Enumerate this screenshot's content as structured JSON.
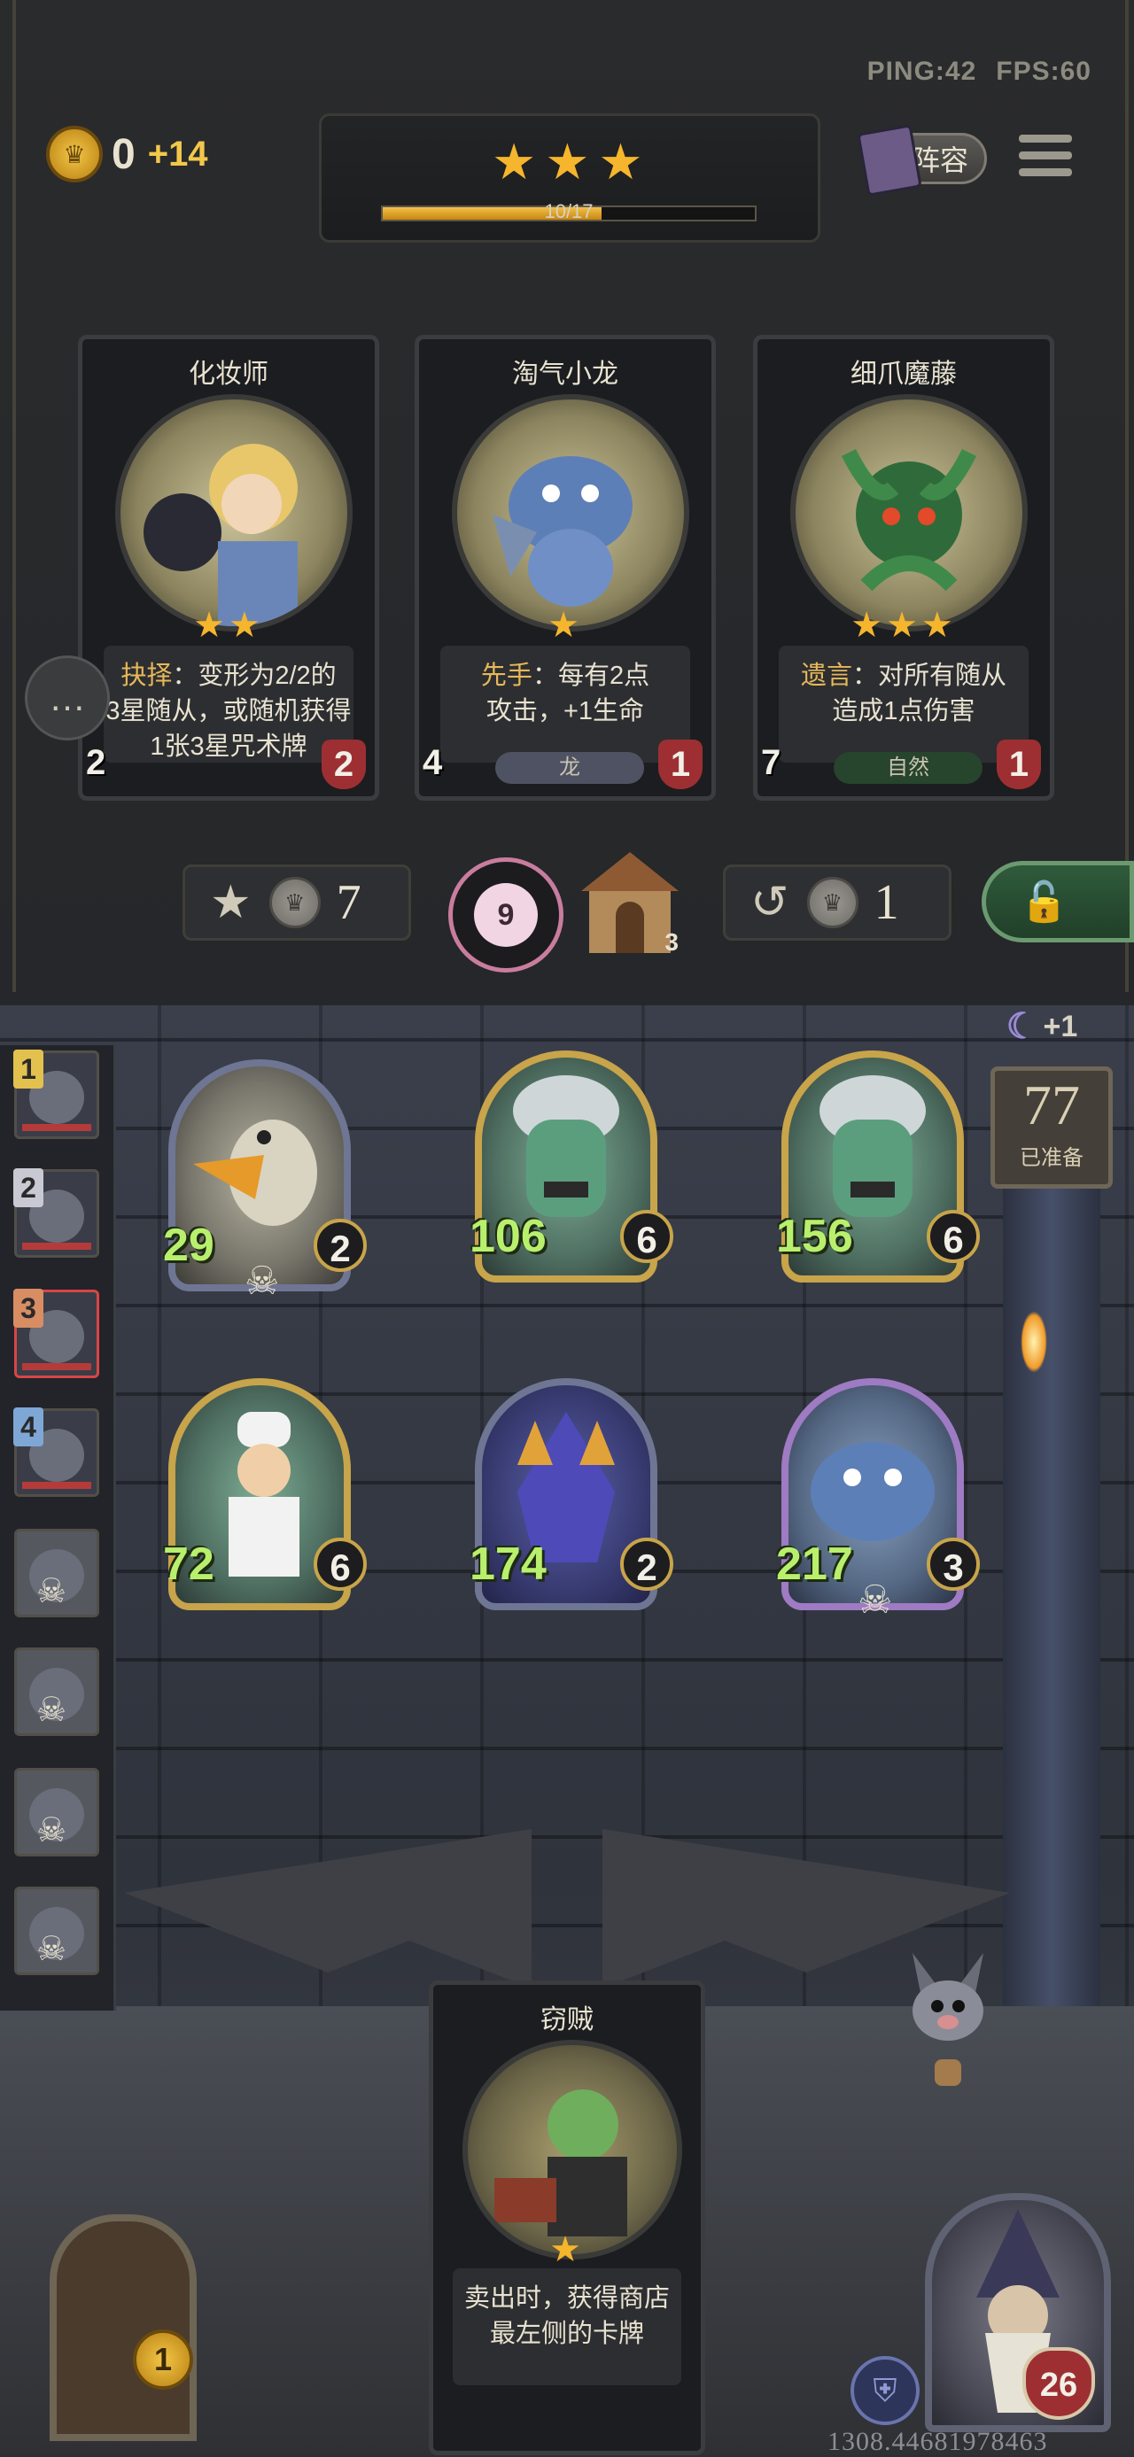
{
  "perf": {
    "ping": "PING:42",
    "fps": "FPS:60"
  },
  "gold": {
    "value": "0",
    "income": "+14"
  },
  "tier": {
    "stars": "★★★",
    "xp_text": "10/17",
    "xp_fraction": 0.588
  },
  "lineup_label": "阵容",
  "shop_cards": [
    {
      "name": "化妆师",
      "stars": "★★",
      "keyword": "抉择",
      "desc_l1": "：变形为2/2的",
      "desc_l2": "3星随从，或随机获得",
      "desc_l3": "1张3星咒术牌",
      "attack": "2",
      "health": "2",
      "tribe": ""
    },
    {
      "name": "淘气小龙",
      "stars": "★",
      "keyword": "先手",
      "desc_l1": "：每有2点",
      "desc_l2": "攻击，+1生命",
      "desc_l3": "",
      "attack": "4",
      "health": "1",
      "tribe": "龙"
    },
    {
      "name": "细爪魔藤",
      "stars": "★★★",
      "keyword": "遗言",
      "desc_l1": "：对所有随从",
      "desc_l2": "造成1点伤害",
      "desc_l3": "",
      "attack": "7",
      "health": "1",
      "tribe": "自然"
    }
  ],
  "actions": {
    "upgrade_cost": "7",
    "freeze_value": "9",
    "tavern_count": "3",
    "refresh_cost": "1"
  },
  "players": [
    {
      "rank": "1"
    },
    {
      "rank": "2"
    },
    {
      "rank": "3"
    },
    {
      "rank": "4"
    }
  ],
  "turn": {
    "bonus": "+1",
    "ready_count": "77",
    "ready_label": "已准备"
  },
  "board": [
    {
      "attack": "29",
      "health": "2"
    },
    {
      "attack": "106",
      "health": "6"
    },
    {
      "attack": "156",
      "health": "6"
    },
    {
      "attack": "72",
      "health": "6"
    },
    {
      "attack": "174",
      "health": "2"
    },
    {
      "attack": "217",
      "health": "3"
    }
  ],
  "hand_card": {
    "name": "窃贼",
    "stars": "★",
    "desc_l1": "卖出时，获得商店",
    "desc_l2": "最左侧的卡牌"
  },
  "recruit_cost": "1",
  "hero": {
    "health": "26"
  },
  "session_id": "1308.44681978463"
}
